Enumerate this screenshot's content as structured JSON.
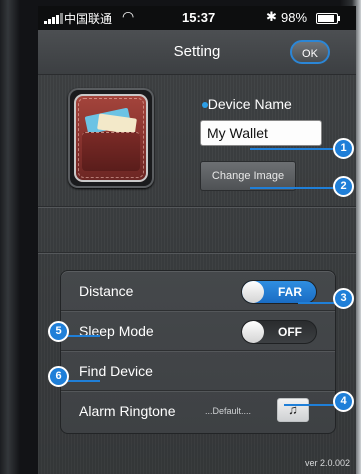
{
  "status_bar": {
    "carrier": "中国联通",
    "time": "15:37",
    "battery": "98%"
  },
  "nav": {
    "title": "Setting",
    "ok_label": "OK"
  },
  "device": {
    "name_label": "Device Name",
    "name_value": "My Wallet",
    "change_image_label": "Change Image"
  },
  "settings": {
    "distance_label": "Distance",
    "distance_value": "FAR",
    "sleep_label": "Sleep Mode",
    "sleep_value": "OFF",
    "find_label": "Find Device",
    "ringtone_label": "Alarm Ringtone",
    "ringtone_value": "...Default...."
  },
  "version": "ver 2.0.002",
  "callouts": [
    "1",
    "2",
    "3",
    "4",
    "5",
    "6"
  ],
  "colors": {
    "accent": "#1f7fd8",
    "toggle_on": "#2f8ee0"
  }
}
